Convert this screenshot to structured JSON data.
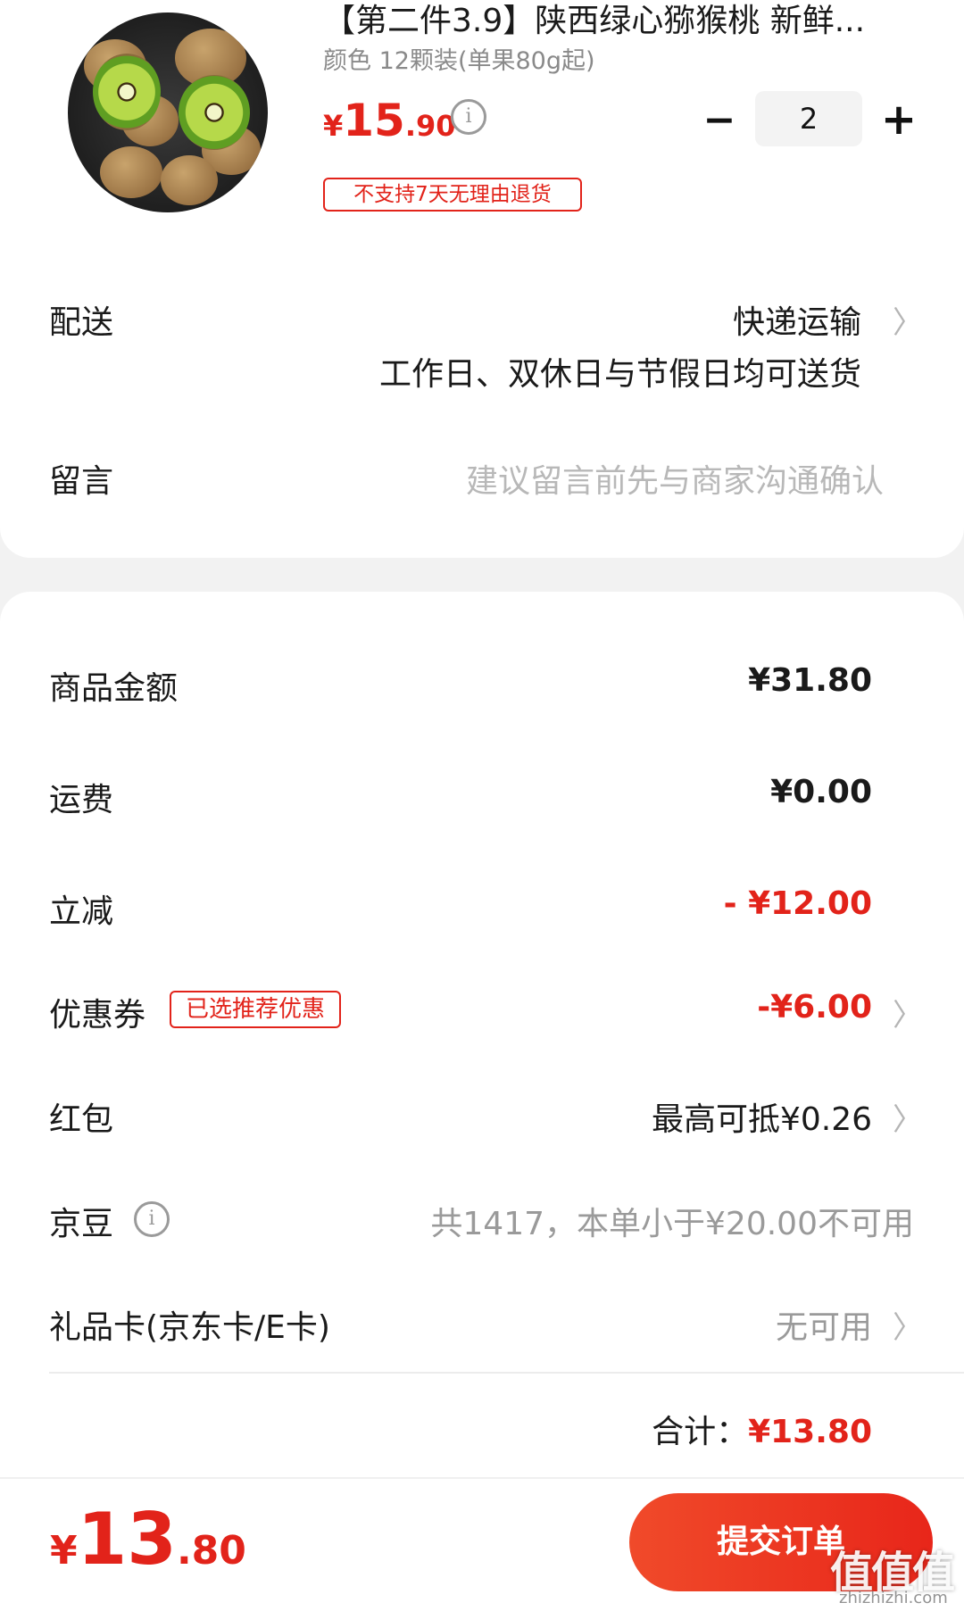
{
  "product": {
    "title": "【第二件3.9】陕西绿心猕猴桃 新鲜...",
    "spec": "颜色 12颗装(单果80g起)",
    "price_currency": "¥",
    "price_int": "15",
    "price_dec": ".90",
    "quantity": "2",
    "minus_symbol": "−",
    "plus_symbol": "+",
    "return_policy": "不支持7天无理由退货"
  },
  "delivery": {
    "label": "配送",
    "method": "快递运输",
    "note": "工作日、双休日与节假日均可送货"
  },
  "message": {
    "label": "留言",
    "placeholder": "建议留言前先与商家沟通确认"
  },
  "summary": {
    "goods_label": "商品金额",
    "goods_value": "¥31.80",
    "shipping_label": "运费",
    "shipping_value": "¥0.00",
    "discount_label": "立减",
    "discount_value": "- ¥12.00",
    "coupon_label": "优惠券",
    "coupon_tag": "已选推荐优惠",
    "coupon_value": "-¥6.00",
    "redpacket_label": "红包",
    "redpacket_value": "最高可抵¥0.26",
    "jd_beans_label": "京豆",
    "jd_beans_value": "共1417，本单小于¥20.00不可用",
    "giftcard_label": "礼品卡(京东卡/E卡)",
    "giftcard_value": "无可用",
    "total_label": "合计：",
    "total_value": "¥13.80"
  },
  "footer": {
    "price_currency": "¥",
    "price_int": "13",
    "price_dec": ".80",
    "submit_label": "提交订单"
  },
  "watermark": {
    "text": "值值值",
    "sub": "zhizhizhi.com"
  },
  "icons": [
    "info-icon",
    "chevron-right-icon",
    "minus-icon",
    "plus-icon"
  ],
  "colors": {
    "accent": "#e2231a",
    "muted": "#8a8a8a",
    "background": "#f2f2f2"
  }
}
